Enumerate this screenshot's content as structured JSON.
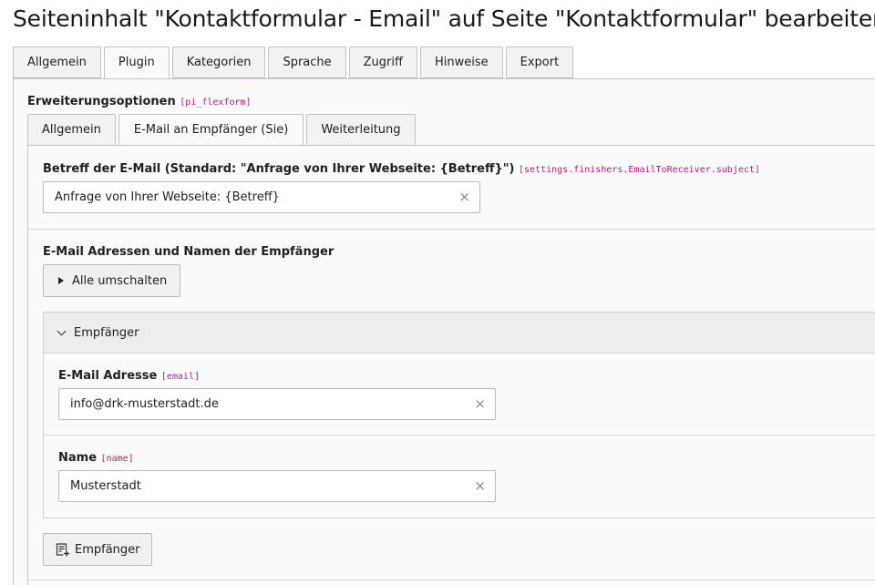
{
  "page": {
    "title": "Seiteninhalt \"Kontaktformular - Email\" auf Seite \"Kontaktformular\" bearbeiten"
  },
  "outer_tabs": [
    {
      "label": "Allgemein"
    },
    {
      "label": "Plugin"
    },
    {
      "label": "Kategorien"
    },
    {
      "label": "Sprache"
    },
    {
      "label": "Zugriff"
    },
    {
      "label": "Hinweise"
    },
    {
      "label": "Export"
    }
  ],
  "active_outer_tab": "Plugin",
  "extension": {
    "label": "Erweiterungsoptionen",
    "code": "[pi_flexform]"
  },
  "inner_tabs": [
    {
      "label": "Allgemein"
    },
    {
      "label": "E-Mail an Empfänger (Sie)"
    },
    {
      "label": "Weiterleitung"
    }
  ],
  "active_inner_tab": "E-Mail an Empfänger (Sie)",
  "subject": {
    "label": "Betreff der E-Mail (Standard: \"Anfrage von Ihrer Webseite: {Betreff}\")",
    "code": "[settings.finishers.EmailToReceiver.subject]",
    "value": "Anfrage von Ihrer Webseite: {Betreff}",
    "clear": "×"
  },
  "recipients": {
    "label": "E-Mail Adressen und Namen der Empfänger",
    "toggle_label": "Alle umschalten",
    "section_title": "Empfänger",
    "email": {
      "label": "E-Mail Adresse",
      "code": "[email]",
      "value": "info@drk-musterstadt.de",
      "clear": "×"
    },
    "name": {
      "label": "Name",
      "code": "[name]",
      "value": "Musterstadt",
      "clear": "×"
    },
    "add_label": "Empfänger"
  },
  "icons": [
    "triangle-right-icon",
    "chevron-down-icon",
    "add-record-icon",
    "clear-icon"
  ]
}
